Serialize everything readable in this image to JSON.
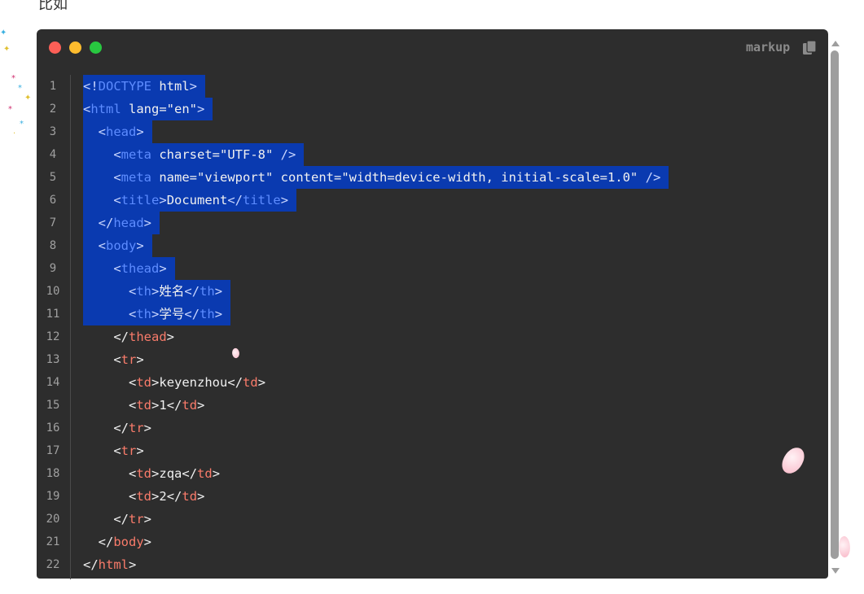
{
  "top_text": "比如",
  "code_block": {
    "language_label": "markup",
    "window_controls": [
      "close",
      "minimize",
      "maximize"
    ],
    "selected_lines": 11,
    "lines": [
      {
        "num": "1",
        "text": "<!DOCTYPE html>"
      },
      {
        "num": "2",
        "text": "<html lang=\"en\">"
      },
      {
        "num": "3",
        "text": "  <head>"
      },
      {
        "num": "4",
        "text": "    <meta charset=\"UTF-8\" />"
      },
      {
        "num": "5",
        "text": "    <meta name=\"viewport\" content=\"width=device-width, initial-scale=1.0\" />"
      },
      {
        "num": "6",
        "text": "    <title>Document</title>"
      },
      {
        "num": "7",
        "text": "  </head>"
      },
      {
        "num": "8",
        "text": "  <body>"
      },
      {
        "num": "9",
        "text": "    <thead>"
      },
      {
        "num": "10",
        "text": "      <th>姓名</th>"
      },
      {
        "num": "11",
        "text": "      <th>学号</th>"
      },
      {
        "num": "12",
        "text": "    </thead>"
      },
      {
        "num": "13",
        "text": "    <tr>"
      },
      {
        "num": "14",
        "text": "      <td>keyenzhou</td>"
      },
      {
        "num": "15",
        "text": "      <td>1</td>"
      },
      {
        "num": "16",
        "text": "    </tr>"
      },
      {
        "num": "17",
        "text": "    <tr>"
      },
      {
        "num": "18",
        "text": "      <td>zqa</td>"
      },
      {
        "num": "19",
        "text": "      <td>2</td>"
      },
      {
        "num": "20",
        "text": "    </tr>"
      },
      {
        "num": "21",
        "text": "  </body>"
      },
      {
        "num": "22",
        "text": "</html>"
      }
    ]
  },
  "colors": {
    "code_bg": "#2d2d2d",
    "selection": "#0a3ab0",
    "tag": "#f97b6a",
    "text": "#f0f0f0",
    "line_number": "#a0a0a0"
  },
  "icons": {
    "copy": "copy-icon",
    "scroll_up": "arrow-up-icon",
    "scroll_down": "arrow-down-icon"
  }
}
